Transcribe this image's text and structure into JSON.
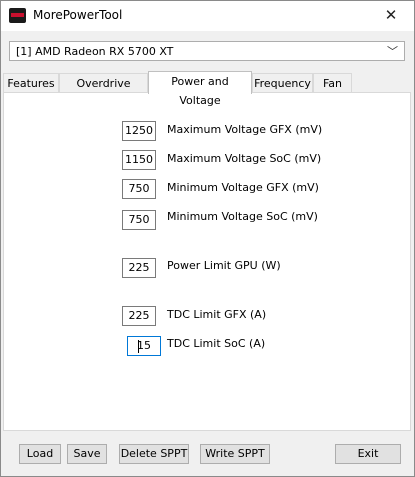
{
  "window": {
    "title": "MorePowerTool",
    "close_glyph": "✕"
  },
  "gpu_select": {
    "value": "[1] AMD Radeon RX 5700 XT",
    "arrow": "﹀"
  },
  "tabs": [
    {
      "label": "Features"
    },
    {
      "label": "Overdrive Limits"
    },
    {
      "label": "Power and Voltage",
      "active": true
    },
    {
      "label": "Frequency"
    },
    {
      "label": "Fan"
    }
  ],
  "fields": {
    "max_voltage_gfx": {
      "value": "1250",
      "label": "Maximum Voltage GFX (mV)"
    },
    "max_voltage_soc": {
      "value": "1150",
      "label": "Maximum Voltage SoC (mV)"
    },
    "min_voltage_gfx": {
      "value": "750",
      "label": "Minimum Voltage GFX (mV)"
    },
    "min_voltage_soc": {
      "value": "750",
      "label": "Minimum Voltage SoC (mV)"
    },
    "power_limit_gpu": {
      "value": "225",
      "label": "Power Limit GPU (W)"
    },
    "tdc_limit_gfx": {
      "value": "225",
      "label": "TDC Limit GFX (A)"
    },
    "tdc_limit_soc": {
      "value": "15",
      "label": "TDC Limit SoC (A)"
    }
  },
  "buttons": {
    "load": "Load",
    "save": "Save",
    "delete_sppt": "Delete SPPT",
    "write_sppt": "Write SPPT",
    "exit": "Exit"
  },
  "icons": {
    "app": "amd-logo-icon",
    "close": "close-icon",
    "dropdown": "chevron-down-icon"
  },
  "colors": {
    "accent": "#0078d7",
    "logo_red": "#c8102e"
  }
}
